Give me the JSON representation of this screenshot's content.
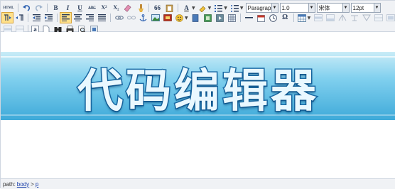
{
  "toolbar": {
    "html_label": "HTML",
    "bold": "B",
    "italic": "I",
    "underline": "U",
    "strikethrough": "ABC",
    "superscript": "X²",
    "subscript": "X₂",
    "quote": "66",
    "font_color": "A",
    "block_format": "Paragraph",
    "line_height": "1.0",
    "font_family": "宋体",
    "font_size": "12pt",
    "special_char": "Ω",
    "anchor": "a"
  },
  "banner": {
    "text": "代码编辑器"
  },
  "statusbar": {
    "path_label": "path:",
    "crumb_body": "body",
    "separator": ">",
    "crumb_p": "p"
  },
  "colors": {
    "toolbar_bg": "#f0f2f5",
    "banner_top": "#c9ecf7",
    "banner_bottom": "#3faad9",
    "banner_text_stroke": "#1b6ca7"
  }
}
